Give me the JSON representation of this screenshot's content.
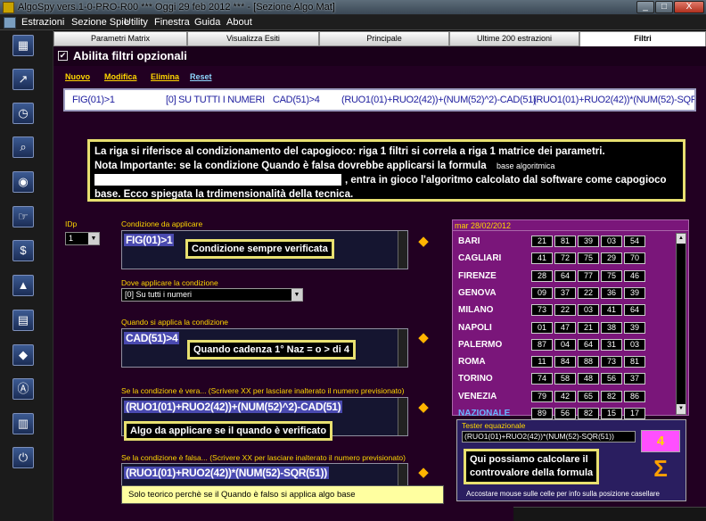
{
  "window": {
    "title": "AlgoSpy vers.1-0-PRO-R00  ***  Oggi 29 feb 2012  ***  - [Sezione Algo Mat]",
    "controls": [
      "_",
      "□",
      "X"
    ]
  },
  "menu": [
    "Estrazioni",
    "Sezione Spie",
    "Utility",
    "Finestra",
    "Guida",
    "About"
  ],
  "sidebar_icons": [
    "calendar-icon",
    "arrows-icon",
    "clock-icon",
    "telescope-icon",
    "bulb-icon",
    "pointer-hand-icon",
    "dollar-icon",
    "tree-icon",
    "grid-icon",
    "diamond-icon",
    "letter-a-icon",
    "book-icon",
    "power-icon"
  ],
  "tabs": [
    {
      "label": "Parametri Matrix",
      "active": false
    },
    {
      "label": "Visualizza Esiti",
      "active": false
    },
    {
      "label": "Principale",
      "active": false
    },
    {
      "label": "Ultime 200 estrazioni",
      "active": false
    },
    {
      "label": "Filtri",
      "active": true
    }
  ],
  "filtri": {
    "enabled_check": "✔",
    "title": "Abilita filtri opzionali",
    "actions": {
      "nuovo": "Nuovo",
      "modifica": "Modifica",
      "elimina": "Elimina",
      "reset": "Reset"
    },
    "row": [
      "FIG(01)>1",
      "[0] SU TUTTI I NUMERI",
      "CAD(51)>4",
      "(RUO1(01)+RUO2(42))+(NUM(52)^2)-CAD(51)",
      "(RUO1(01)+RUO2(42))*(NUM(52)-SQR(51))"
    ]
  },
  "note": {
    "line1": "La riga si riferisce al condizionamento del capogioco: riga 1 filtri si correla a riga 1 matrice dei parametri.",
    "line2": "Nota Importante: se la condizione Quando è falsa dovrebbe applicarsi la formula",
    "base_label": "base algoritmica",
    "line3": ", entra in gioco l'algoritmo calcolato dal software come capogioco",
    "line4": "base. Ecco spiegata la trdimensionalità della tecnica."
  },
  "form": {
    "idp_label": "IDp",
    "idp_value": "1",
    "condizione_label": "Condizione da applicare",
    "condizione_value": "FIG(01)>1",
    "callout_cond": "Condizione sempre verificata",
    "dove_label": "Dove applicare la condizione",
    "dove_value": "[0] Su tutti i numeri",
    "quando_label": "Quando si applica la condizione",
    "quando_value": "CAD(51)>4",
    "callout_quando": "Quando cadenza 1° Naz = o > di 4",
    "vera_label": "Se la condizione è vera... (Scrivere XX per lasciare inalterato il numero previsionato)",
    "vera_value": "(RUO1(01)+RUO2(42))+(NUM(52)^2)-CAD(51)",
    "callout_vera": "Algo da applicare se il quando è verificato",
    "falsa_label": "Se la condizione è falsa... (Scrivere XX per lasciare inalterato il numero previsionato)",
    "falsa_value": "(RUO1(01)+RUO2(42))*(NUM(52)-SQR(51))",
    "solo_note": "Solo teorico perchè se il Quando è falso si applica algo base"
  },
  "estrazione": {
    "date": "mar 28/02/2012",
    "ruote": [
      {
        "name": "BARI",
        "nums": [
          "21",
          "81",
          "39",
          "03",
          "54"
        ]
      },
      {
        "name": "CAGLIARI",
        "nums": [
          "41",
          "72",
          "75",
          "29",
          "70"
        ]
      },
      {
        "name": "FIRENZE",
        "nums": [
          "28",
          "64",
          "77",
          "75",
          "46"
        ]
      },
      {
        "name": "GENOVA",
        "nums": [
          "09",
          "37",
          "22",
          "36",
          "39"
        ]
      },
      {
        "name": "MILANO",
        "nums": [
          "73",
          "22",
          "03",
          "41",
          "64"
        ]
      },
      {
        "name": "NAPOLI",
        "nums": [
          "01",
          "47",
          "21",
          "38",
          "39"
        ]
      },
      {
        "name": "PALERMO",
        "nums": [
          "87",
          "04",
          "64",
          "31",
          "03"
        ]
      },
      {
        "name": "ROMA",
        "nums": [
          "11",
          "84",
          "88",
          "73",
          "81"
        ]
      },
      {
        "name": "TORINO",
        "nums": [
          "74",
          "58",
          "48",
          "56",
          "37"
        ]
      },
      {
        "name": "VENEZIA",
        "nums": [
          "79",
          "42",
          "65",
          "82",
          "86"
        ]
      },
      {
        "name": "NAZIONALE",
        "nums": [
          "89",
          "56",
          "82",
          "15",
          "17"
        ]
      }
    ]
  },
  "tester": {
    "label": "Tester equazionale",
    "formula": "(RUO1(01)+RUO2(42))*(NUM(52)-SQR(51))",
    "result": "4",
    "sigma": "Σ",
    "callout_line1": "Qui possiamo calcolare il",
    "callout_line2": "controvalore della formula",
    "info": "Accostare mouse sulle celle per info sulla posizione casellare"
  }
}
